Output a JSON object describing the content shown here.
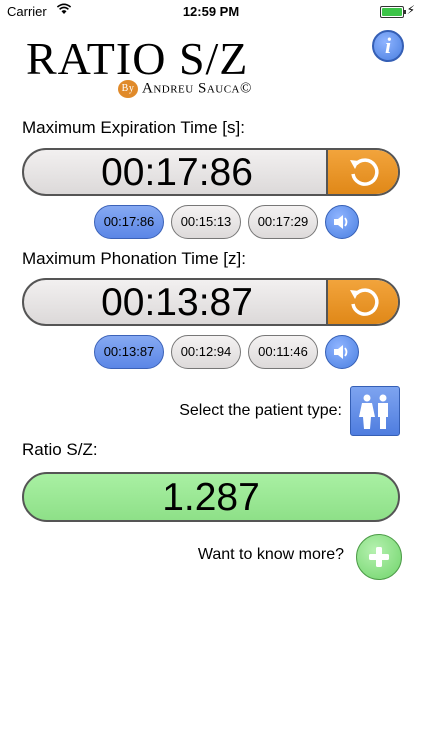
{
  "status_bar": {
    "carrier": "Carrier",
    "time": "12:59 PM",
    "battery_level_percent": 100
  },
  "header": {
    "title": "RATIO S/Z",
    "by": "By",
    "author": "Andreu Sauca©",
    "info_icon": "info-icon"
  },
  "expiration": {
    "label": "Maximum Expiration Time [s]:",
    "current": "00:17:86",
    "attempts": [
      "00:17:86",
      "00:15:13",
      "00:17:29"
    ],
    "selected_index": 0
  },
  "phonation": {
    "label": "Maximum Phonation Time [z]:",
    "current": "00:13:87",
    "attempts": [
      "00:13:87",
      "00:12:94",
      "00:11:46"
    ],
    "selected_index": 0
  },
  "patient": {
    "label": "Select the patient type:",
    "icon": "adult-patient-icon"
  },
  "ratio": {
    "label": "Ratio S/Z:",
    "value": "1.287"
  },
  "more": {
    "label": "Want to know more?",
    "icon": "plus-icon"
  },
  "colors": {
    "accent_orange": "#e08818",
    "accent_blue": "#5b86e6",
    "result_green": "#8ee088"
  }
}
